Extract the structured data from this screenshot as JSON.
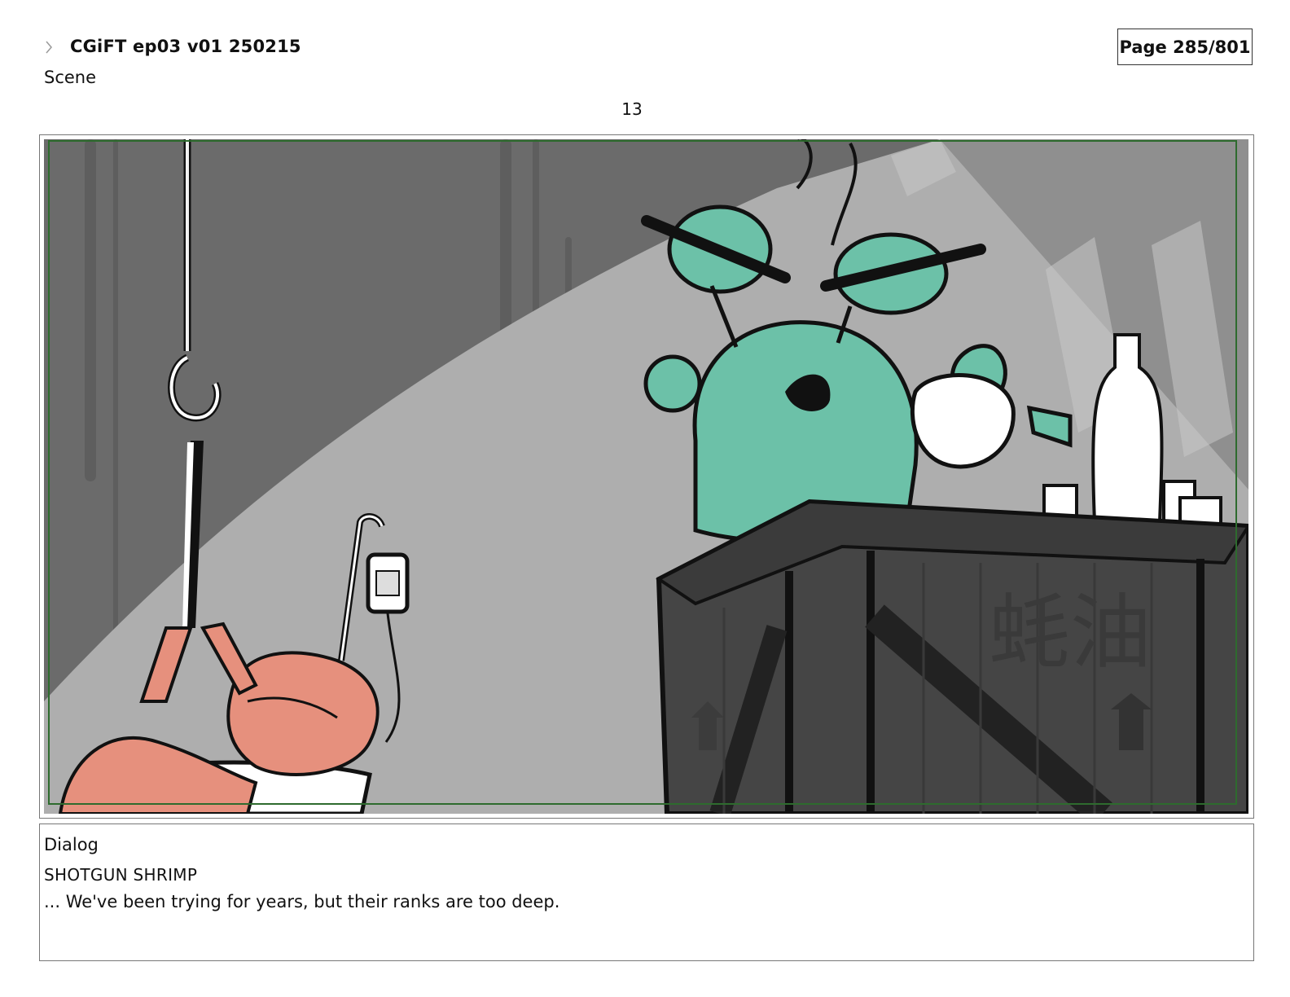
{
  "header": {
    "title": "CGiFT ep03 v01 250215",
    "page": "Page 285/801",
    "scene_label": "Scene",
    "scene_number": "13"
  },
  "panel": {
    "crate_marking": "蚝油"
  },
  "dialog": {
    "label": "Dialog",
    "speaker": "SHOTGUN SHRIMP",
    "line": "... We've been trying for years, but their ranks are too deep."
  },
  "colors": {
    "wall": "#6b6b6b",
    "spotlight": "#aeaeae",
    "crate": "#454545",
    "creature": "#6cc1a8",
    "shrimp": "#e6907d",
    "safe_frame": "#2e6b2e"
  }
}
